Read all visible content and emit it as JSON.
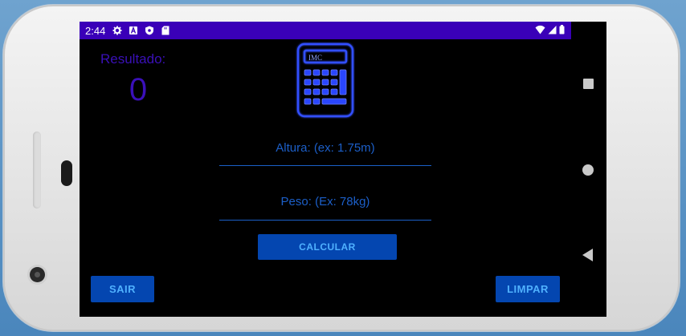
{
  "status_bar": {
    "time": "2:44",
    "icons": [
      "settings-icon",
      "a-icon",
      "shield-icon",
      "sd-card-icon"
    ],
    "right_icons": [
      "wifi-icon",
      "signal-icon",
      "battery-icon"
    ]
  },
  "app": {
    "result_label": "Resultado:",
    "result_value": "0",
    "calculator_icon_text": "IMC",
    "height_placeholder": "Altura: (ex: 1.75m)",
    "weight_placeholder": "Peso: (Ex: 78kg)",
    "calculate_button": "CALCULAR",
    "exit_button": "SAIR",
    "clear_button": "LIMPAR"
  },
  "colors": {
    "status_bar": "#3a00b8",
    "accent_text": "#3a10b8",
    "field_text": "#1c5fc8",
    "button_bg": "#0446b0",
    "button_text": "#4fb1ff",
    "icon_glow": "#2d4bff"
  },
  "nav_bar": [
    "recents-icon",
    "home-icon",
    "back-icon"
  ]
}
